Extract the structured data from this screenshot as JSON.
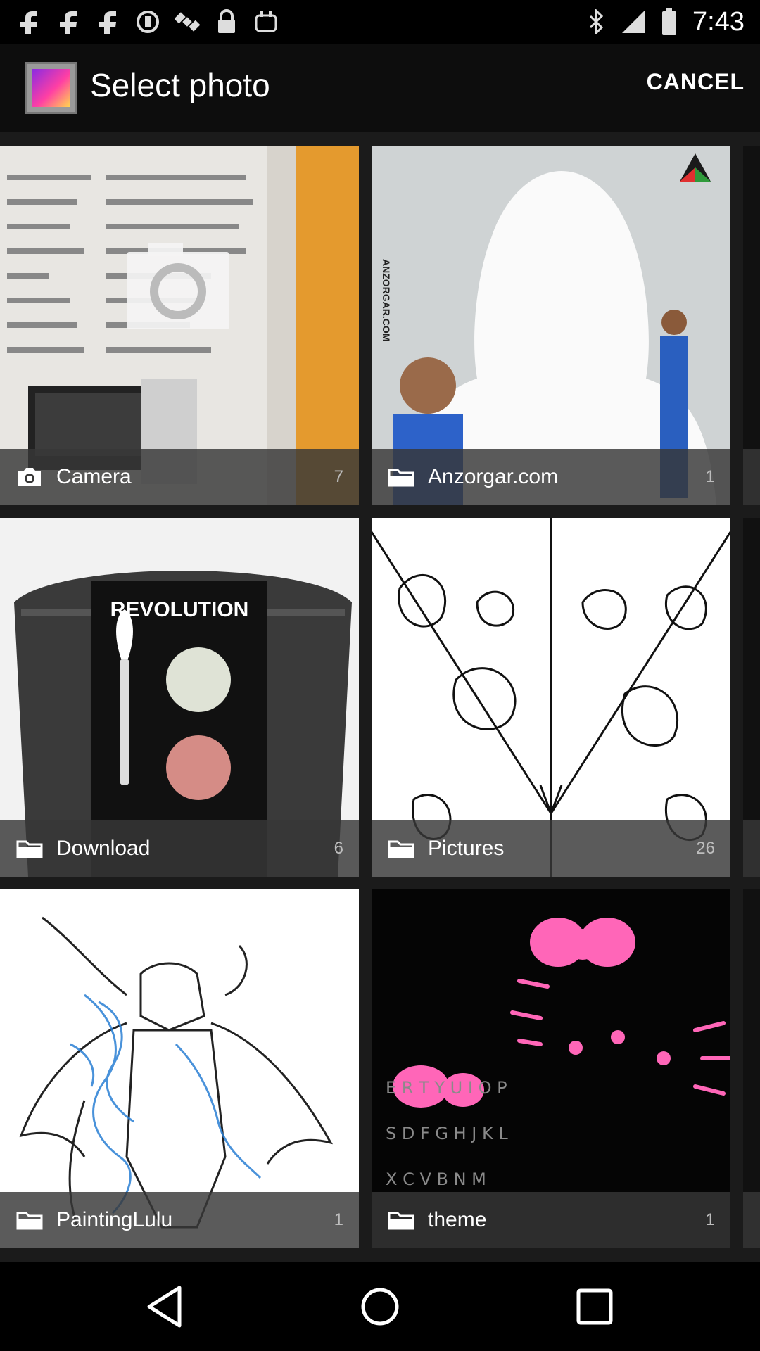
{
  "status_bar": {
    "time": "7:43",
    "left_icons": [
      "facebook-icon",
      "facebook-icon",
      "facebook-icon",
      "circle-icon",
      "satellite-icon",
      "lock-icon",
      "android-icon"
    ],
    "right_icons": [
      "bluetooth-icon",
      "signal-icon",
      "battery-icon"
    ]
  },
  "header": {
    "title": "Select photo",
    "cancel_label": "CANCEL"
  },
  "albums": [
    {
      "name": "Camera",
      "count": "7",
      "icon": "camera-icon"
    },
    {
      "name": "Anzorgar.com",
      "count": "1",
      "icon": "folder-icon"
    },
    {
      "name": "Download",
      "count": "6",
      "icon": "folder-icon"
    },
    {
      "name": "Pictures",
      "count": "26",
      "icon": "folder-icon"
    },
    {
      "name": "PaintingLulu",
      "count": "1",
      "icon": "folder-icon"
    },
    {
      "name": "theme",
      "count": "1",
      "icon": "folder-icon"
    }
  ],
  "thumb_text": {
    "revolution": "REVOLUTION",
    "anzorgar": "ANZORGAR.COM"
  },
  "nav": {
    "back": "back-icon",
    "home": "home-icon",
    "recents": "recents-icon"
  },
  "colors": {
    "background": "#1b1b1b",
    "label_overlay": "#373737"
  }
}
